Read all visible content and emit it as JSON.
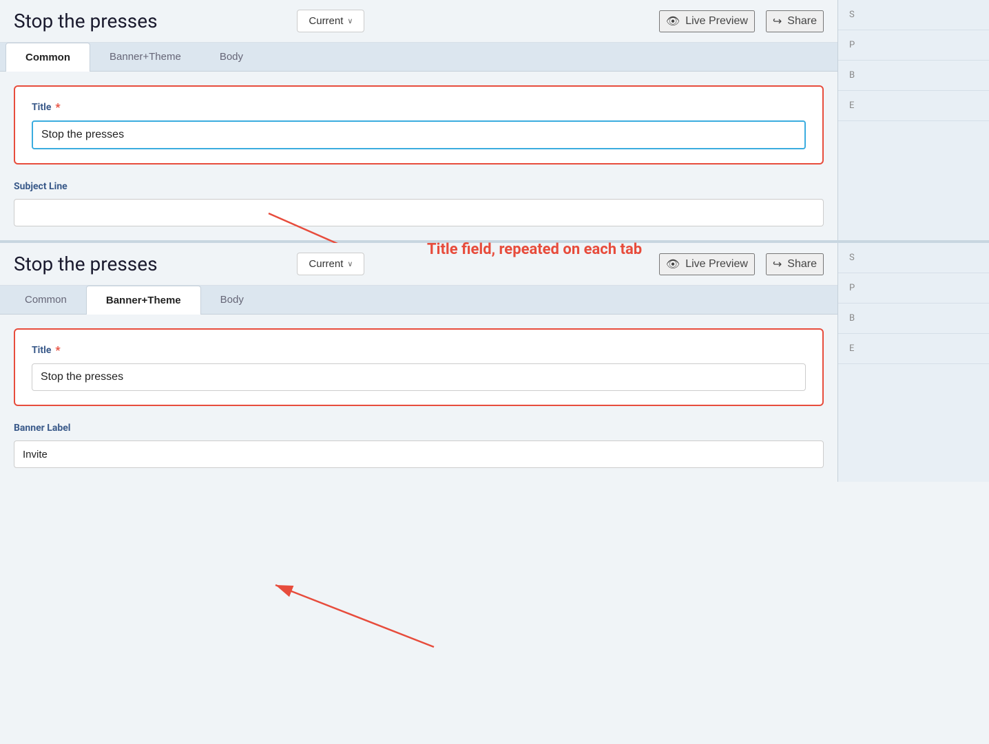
{
  "panel1": {
    "header": {
      "title": "Stop the presses",
      "current_label": "Current",
      "chevron": "∨",
      "live_preview_label": "Live Preview",
      "share_label": "Share"
    },
    "tabs": [
      {
        "id": "common",
        "label": "Common",
        "active": true
      },
      {
        "id": "banner-theme",
        "label": "Banner+Theme",
        "active": false
      },
      {
        "id": "body",
        "label": "Body",
        "active": false
      }
    ],
    "form": {
      "title_label": "Title",
      "title_required": "*",
      "title_value": "Stop the presses",
      "subject_line_label": "Subject Line",
      "subject_line_value": ""
    }
  },
  "annotation": {
    "text": "Title field, repeated on each tab"
  },
  "panel2": {
    "header": {
      "title": "Stop the presses",
      "current_label": "Current",
      "chevron": "∨",
      "live_preview_label": "Live Preview",
      "share_label": "Share"
    },
    "tabs": [
      {
        "id": "common",
        "label": "Common",
        "active": false
      },
      {
        "id": "banner-theme",
        "label": "Banner+Theme",
        "active": true
      },
      {
        "id": "body",
        "label": "Body",
        "active": false
      }
    ],
    "form": {
      "title_label": "Title",
      "title_required": "*",
      "title_value": "Stop the presses",
      "banner_label": "Banner Label",
      "banner_value": "Invite"
    }
  },
  "sidebar1": {
    "items": [
      "S",
      "P",
      "B",
      "E"
    ]
  },
  "sidebar2": {
    "items": [
      "S",
      "P",
      "B",
      "E"
    ]
  },
  "icons": {
    "eye": "👁",
    "share": "↪"
  }
}
